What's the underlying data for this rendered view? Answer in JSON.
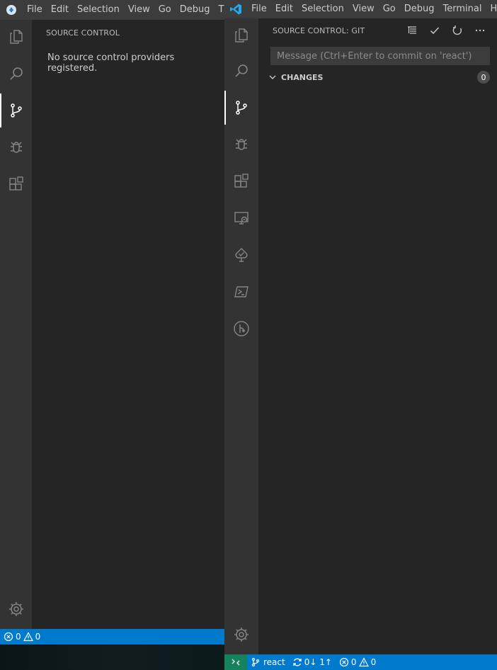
{
  "left_window": {
    "menu": [
      "File",
      "Edit",
      "Selection",
      "View",
      "Go",
      "Debug",
      "T"
    ],
    "sidebar": {
      "title": "SOURCE CONTROL",
      "message": "No source control providers registered."
    },
    "status": {
      "errors": "0",
      "warnings": "0"
    }
  },
  "right_window": {
    "menu": [
      "File",
      "Edit",
      "Selection",
      "View",
      "Go",
      "Debug",
      "Terminal",
      "H"
    ],
    "sidebar": {
      "title": "SOURCE CONTROL: GIT",
      "commit_placeholder": "Message (Ctrl+Enter to commit on 'react')",
      "changes_label": "CHANGES",
      "changes_count": "0"
    },
    "status": {
      "branch": "react",
      "sync": "0↓ 1↑",
      "errors": "0",
      "warnings": "0"
    }
  },
  "colors": {
    "accent": "#007acc",
    "remote": "#16825d",
    "activity_bar": "#333333",
    "sidebar": "#252526",
    "menubar": "#3c3c3c"
  }
}
